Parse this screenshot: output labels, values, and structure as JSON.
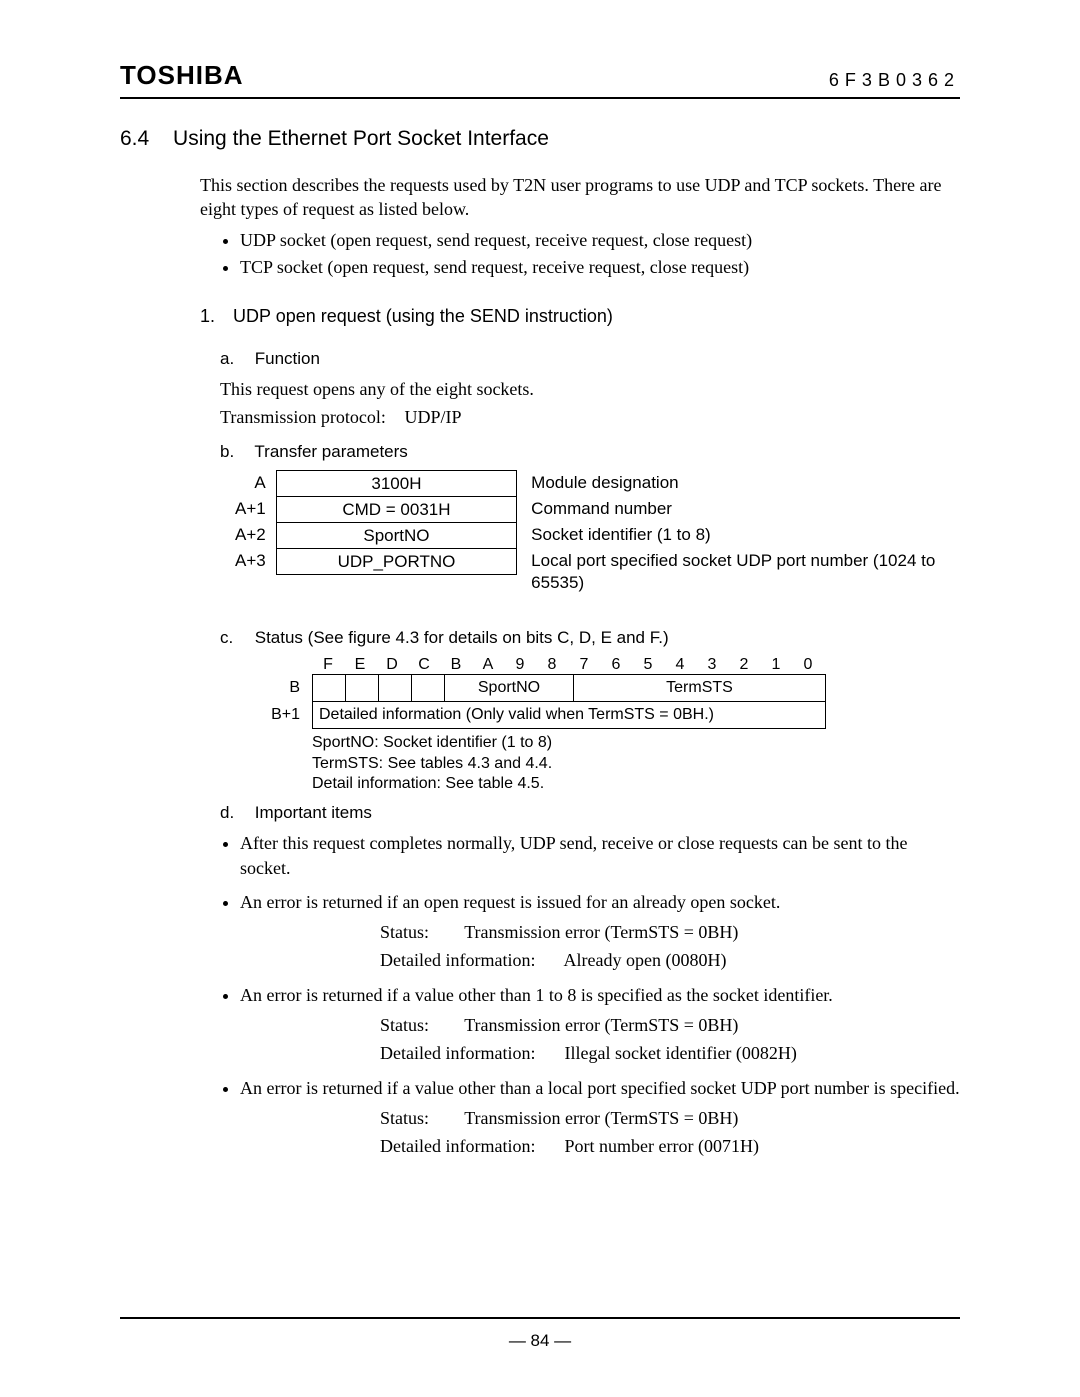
{
  "header": {
    "logo": "TOSHIBA",
    "doc_number": "6F3B0362"
  },
  "section": {
    "number": "6.4",
    "title": "Using the Ethernet Port Socket Interface",
    "intro_p1": "This section describes the requests used by T2N user programs to use UDP and TCP sockets. There are eight types of request as listed below.",
    "intro_bullets": [
      "UDP socket (open request, send request, receive request, close request)",
      "TCP socket (open request, send request, receive request, close request)"
    ]
  },
  "item1": {
    "num": "1.",
    "title": "UDP open request (using the SEND instruction)",
    "a_label": "a.",
    "a_title": "Function",
    "a_p1": "This request opens any of the eight sockets.",
    "proto_label": "Transmission protocol:",
    "proto_value": "UDP/IP",
    "b_label": "b.",
    "b_title": "Transfer parameters",
    "transfer_table": {
      "rows": [
        {
          "addr": "A",
          "value": "3100H",
          "desc": "Module designation"
        },
        {
          "addr": "A+1",
          "value": "CMD = 0031H",
          "desc": "Command number"
        },
        {
          "addr": "A+2",
          "value": "SportNO",
          "desc": "Socket identifier (1 to 8)"
        },
        {
          "addr": "A+3",
          "value": "UDP_PORTNO",
          "desc": "Local port specified socket UDP port number (1024 to 65535)"
        }
      ]
    },
    "c_label": "c.",
    "c_title": "Status (See figure 4.3 for details on bits C, D, E and F.)",
    "status_bits": [
      "F",
      "E",
      "D",
      "C",
      "B",
      "A",
      "9",
      "8",
      "7",
      "6",
      "5",
      "4",
      "3",
      "2",
      "1",
      "0"
    ],
    "status_rowB_label": "B",
    "status_rowB_sport": "SportNO",
    "status_rowB_term": "TermSTS",
    "status_rowB1_label": "B+1",
    "status_rowB1_text": "Detailed information (Only valid when TermSTS = 0BH.)",
    "status_notes": [
      "SportNO:  Socket identifier (1 to 8)",
      "TermSTS: See tables 4.3 and 4.4.",
      "Detail information:  See table 4.5."
    ],
    "d_label": "d.",
    "d_title": "Important items",
    "important": [
      {
        "text": "After this request completes normally, UDP send, receive or close requests can be sent to the socket."
      },
      {
        "text": "An error is returned if an open request is issued for an already open socket.",
        "status": "Transmission error (TermSTS = 0BH)",
        "detail": "Already open (0080H)"
      },
      {
        "text": "An error is returned if a value other than 1 to 8 is specified as the socket identifier.",
        "status": "Transmission error (TermSTS = 0BH)",
        "detail": "Illegal socket identifier (0082H)"
      },
      {
        "text": "An error is returned if a value other than a local port specified socket UDP port number is specified.",
        "status": "Transmission error (TermSTS = 0BH)",
        "detail": "Port number error (0071H)"
      }
    ],
    "labels": {
      "status_lbl": "Status:",
      "detail_lbl": "Detailed information:"
    }
  },
  "footer": {
    "page": "— 84 —"
  }
}
